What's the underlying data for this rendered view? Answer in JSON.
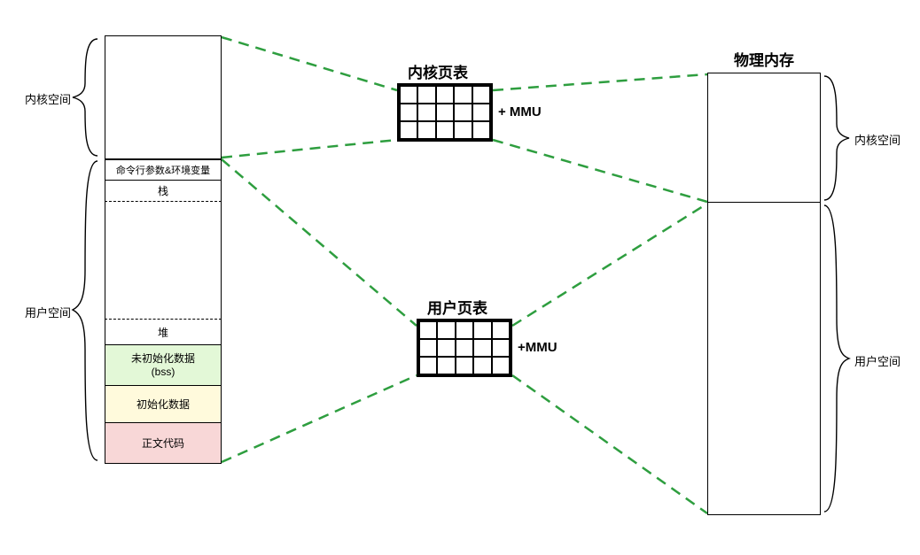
{
  "left": {
    "kernel_label": "内核空间",
    "user_label": "用户空间",
    "segments": {
      "argv_env": "命令行参数&环境变量",
      "stack": "栈",
      "heap": "堆",
      "bss": "未初始化数据\n(bss)",
      "data": "初始化数据",
      "text": "正文代码"
    }
  },
  "center": {
    "kernel_pt": "内核页表",
    "user_pt": "用户页表",
    "mmu1": "+ MMU",
    "mmu2": "+MMU"
  },
  "right": {
    "phys_title": "物理内存",
    "kernel_label": "内核空间",
    "user_label": "用户空间"
  },
  "colors": {
    "bss": "#e3f8d7",
    "data": "#fffadc",
    "text": "#f8d7d7",
    "dash": "#2e9e3f"
  }
}
